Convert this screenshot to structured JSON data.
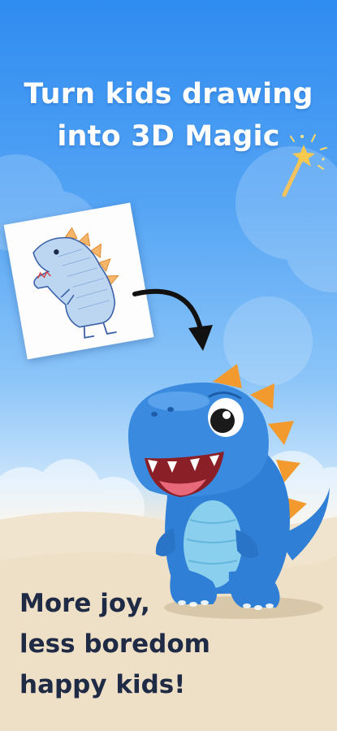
{
  "headline": {
    "line1": "Turn kids drawing",
    "line2": "into 3D Magic"
  },
  "tagline": {
    "line1": "More joy,",
    "line2": "less boredom",
    "line3": "happy kids!"
  },
  "colors": {
    "sky_top": "#2f8cf0",
    "sand": "#f1e4cf",
    "dino_blue": "#2f7fd6",
    "spike_orange": "#f29a2e"
  },
  "icons": [
    "magic-wand-icon",
    "curved-arrow-icon"
  ]
}
